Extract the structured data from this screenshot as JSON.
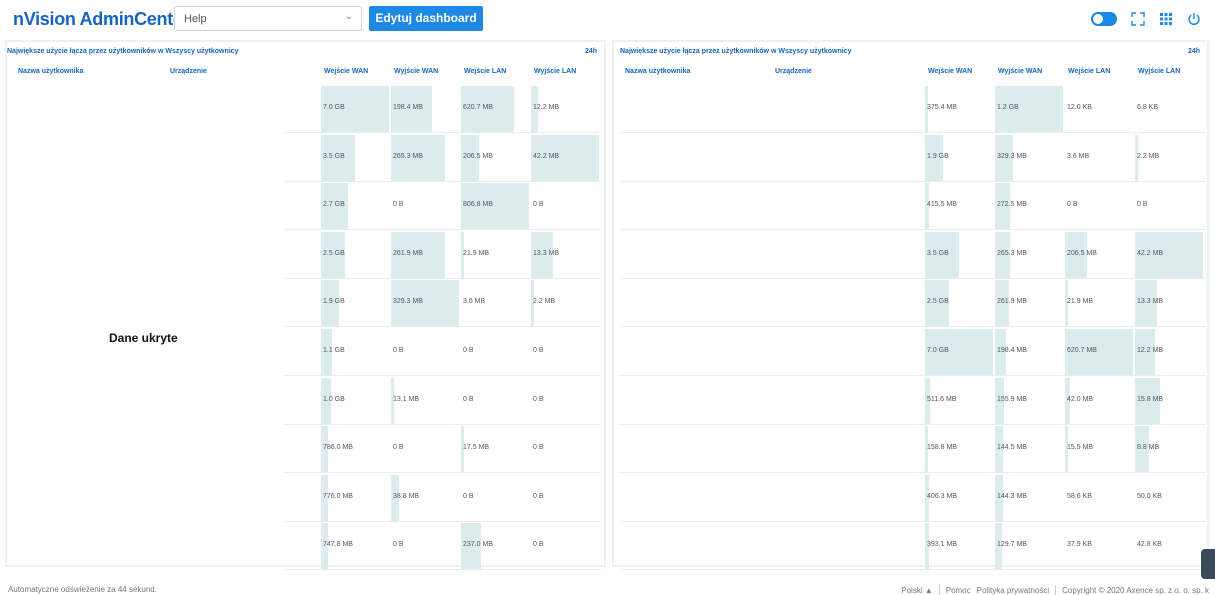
{
  "header": {
    "logo": "nVision AdminCenter",
    "dashboard_select": "Help",
    "edit_button": "Edytuj dashboard"
  },
  "columns": {
    "user": "Nazwa użytkownika",
    "device": "Urządzenie",
    "wan_in": "Wejście WAN",
    "wan_out": "Wyjście WAN",
    "lan_in": "Wejście LAN",
    "lan_out": "Wyjście LAN"
  },
  "left_panel": {
    "title": "Największe użycie łącza przez użytkowników w Wszyscy użytkownicy",
    "period": "24h",
    "hidden_label": "Dane ukryte",
    "rows": [
      {
        "wan_in": "7.0 GB",
        "wan_out": "198.4 MB",
        "lan_in": "620.7 MB",
        "lan_out": "12.2 MB",
        "f": [
          1.0,
          0.6,
          0.78,
          0.1
        ]
      },
      {
        "wan_in": "3.5 GB",
        "wan_out": "265.3 MB",
        "lan_in": "206.5 MB",
        "lan_out": "42.2 MB",
        "f": [
          0.5,
          0.8,
          0.26,
          1.0
        ]
      },
      {
        "wan_in": "2.7 GB",
        "wan_out": "0 B",
        "lan_in": "806.8 MB",
        "lan_out": "0 B",
        "f": [
          0.39,
          0.0,
          1.0,
          0.0
        ]
      },
      {
        "wan_in": "2.5 GB",
        "wan_out": "261.9 MB",
        "lan_in": "21.9 MB",
        "lan_out": "13.3 MB",
        "f": [
          0.36,
          0.79,
          0.03,
          0.32
        ]
      },
      {
        "wan_in": "1.9 GB",
        "wan_out": "329.3 MB",
        "lan_in": "3.6 MB",
        "lan_out": "2.2 MB",
        "f": [
          0.27,
          1.0,
          0.0,
          0.05
        ]
      },
      {
        "wan_in": "1.1 GB",
        "wan_out": "0 B",
        "lan_in": "0 B",
        "lan_out": "0 B",
        "f": [
          0.16,
          0.0,
          0.0,
          0.0
        ]
      },
      {
        "wan_in": "1.0 GB",
        "wan_out": "13.1 MB",
        "lan_in": "0 B",
        "lan_out": "0 B",
        "f": [
          0.14,
          0.04,
          0.0,
          0.0
        ]
      },
      {
        "wan_in": "786.0 MB",
        "wan_out": "0 B",
        "lan_in": "17.5 MB",
        "lan_out": "0 B",
        "f": [
          0.11,
          0.0,
          0.02,
          0.0
        ]
      },
      {
        "wan_in": "776.0 MB",
        "wan_out": "38.8 MB",
        "lan_in": "0 B",
        "lan_out": "0 B",
        "f": [
          0.11,
          0.12,
          0.0,
          0.0
        ]
      },
      {
        "wan_in": "747.8 MB",
        "wan_out": "0 B",
        "lan_in": "237.0 MB",
        "lan_out": "0 B",
        "f": [
          0.11,
          0.0,
          0.29,
          0.0
        ]
      }
    ]
  },
  "right_panel": {
    "title": "Największe użycie łącza przez użytkowników w Wszyscy użytkownicy",
    "period": "24h",
    "rows": [
      {
        "wan_in": "375.4 MB",
        "wan_out": "1.2 GB",
        "lan_in": "12.0 KB",
        "lan_out": "6.8 KB",
        "f": [
          0.05,
          1.0,
          0.0,
          0.0
        ]
      },
      {
        "wan_in": "1.9 GB",
        "wan_out": "329.3 MB",
        "lan_in": "3.6 MB",
        "lan_out": "2.2 MB",
        "f": [
          0.27,
          0.27,
          0.0,
          0.05
        ]
      },
      {
        "wan_in": "415.5 MB",
        "wan_out": "272.5 MB",
        "lan_in": "0 B",
        "lan_out": "0 B",
        "f": [
          0.06,
          0.22,
          0.0,
          0.0
        ]
      },
      {
        "wan_in": "3.5 GB",
        "wan_out": "265.3 MB",
        "lan_in": "206.5 MB",
        "lan_out": "42.2 MB",
        "f": [
          0.5,
          0.22,
          0.33,
          1.0
        ]
      },
      {
        "wan_in": "2.5 GB",
        "wan_out": "261.9 MB",
        "lan_in": "21.9 MB",
        "lan_out": "13.3 MB",
        "f": [
          0.36,
          0.21,
          0.03,
          0.32
        ]
      },
      {
        "wan_in": "7.0 GB",
        "wan_out": "198.4 MB",
        "lan_in": "620.7 MB",
        "lan_out": "12.2 MB",
        "f": [
          1.0,
          0.16,
          1.0,
          0.29
        ]
      },
      {
        "wan_in": "511.6 MB",
        "wan_out": "155.9 MB",
        "lan_in": "42.0 MB",
        "lan_out": "15.8 MB",
        "f": [
          0.07,
          0.13,
          0.07,
          0.37
        ]
      },
      {
        "wan_in": "158.8 MB",
        "wan_out": "144.5 MB",
        "lan_in": "15.5 MB",
        "lan_out": "8.8 MB",
        "f": [
          0.02,
          0.12,
          0.02,
          0.21
        ]
      },
      {
        "wan_in": "406.3 MB",
        "wan_out": "144.3 MB",
        "lan_in": "58.6 KB",
        "lan_out": "50.0 KB",
        "f": [
          0.06,
          0.12,
          0.0,
          0.0
        ]
      },
      {
        "wan_in": "393.1 MB",
        "wan_out": "129.7 MB",
        "lan_in": "37.9 KB",
        "lan_out": "42.8 KB",
        "f": [
          0.06,
          0.11,
          0.0,
          0.0
        ]
      }
    ]
  },
  "footer": {
    "refresh": "Automatyczne odświeżenie za 44 sekund.",
    "language": "Polski ▲",
    "help": "Pomoc",
    "privacy": "Polityka prywatności",
    "copyright": "Copyright © 2020  Axence sp. z o. o. sp. k"
  },
  "colors": {
    "accent": "#1e88e5",
    "brand": "#1565c0",
    "bar": "#dcecec"
  },
  "icons": [
    "toggle-switch-icon",
    "fullscreen-icon",
    "grid-icon",
    "power-icon"
  ]
}
